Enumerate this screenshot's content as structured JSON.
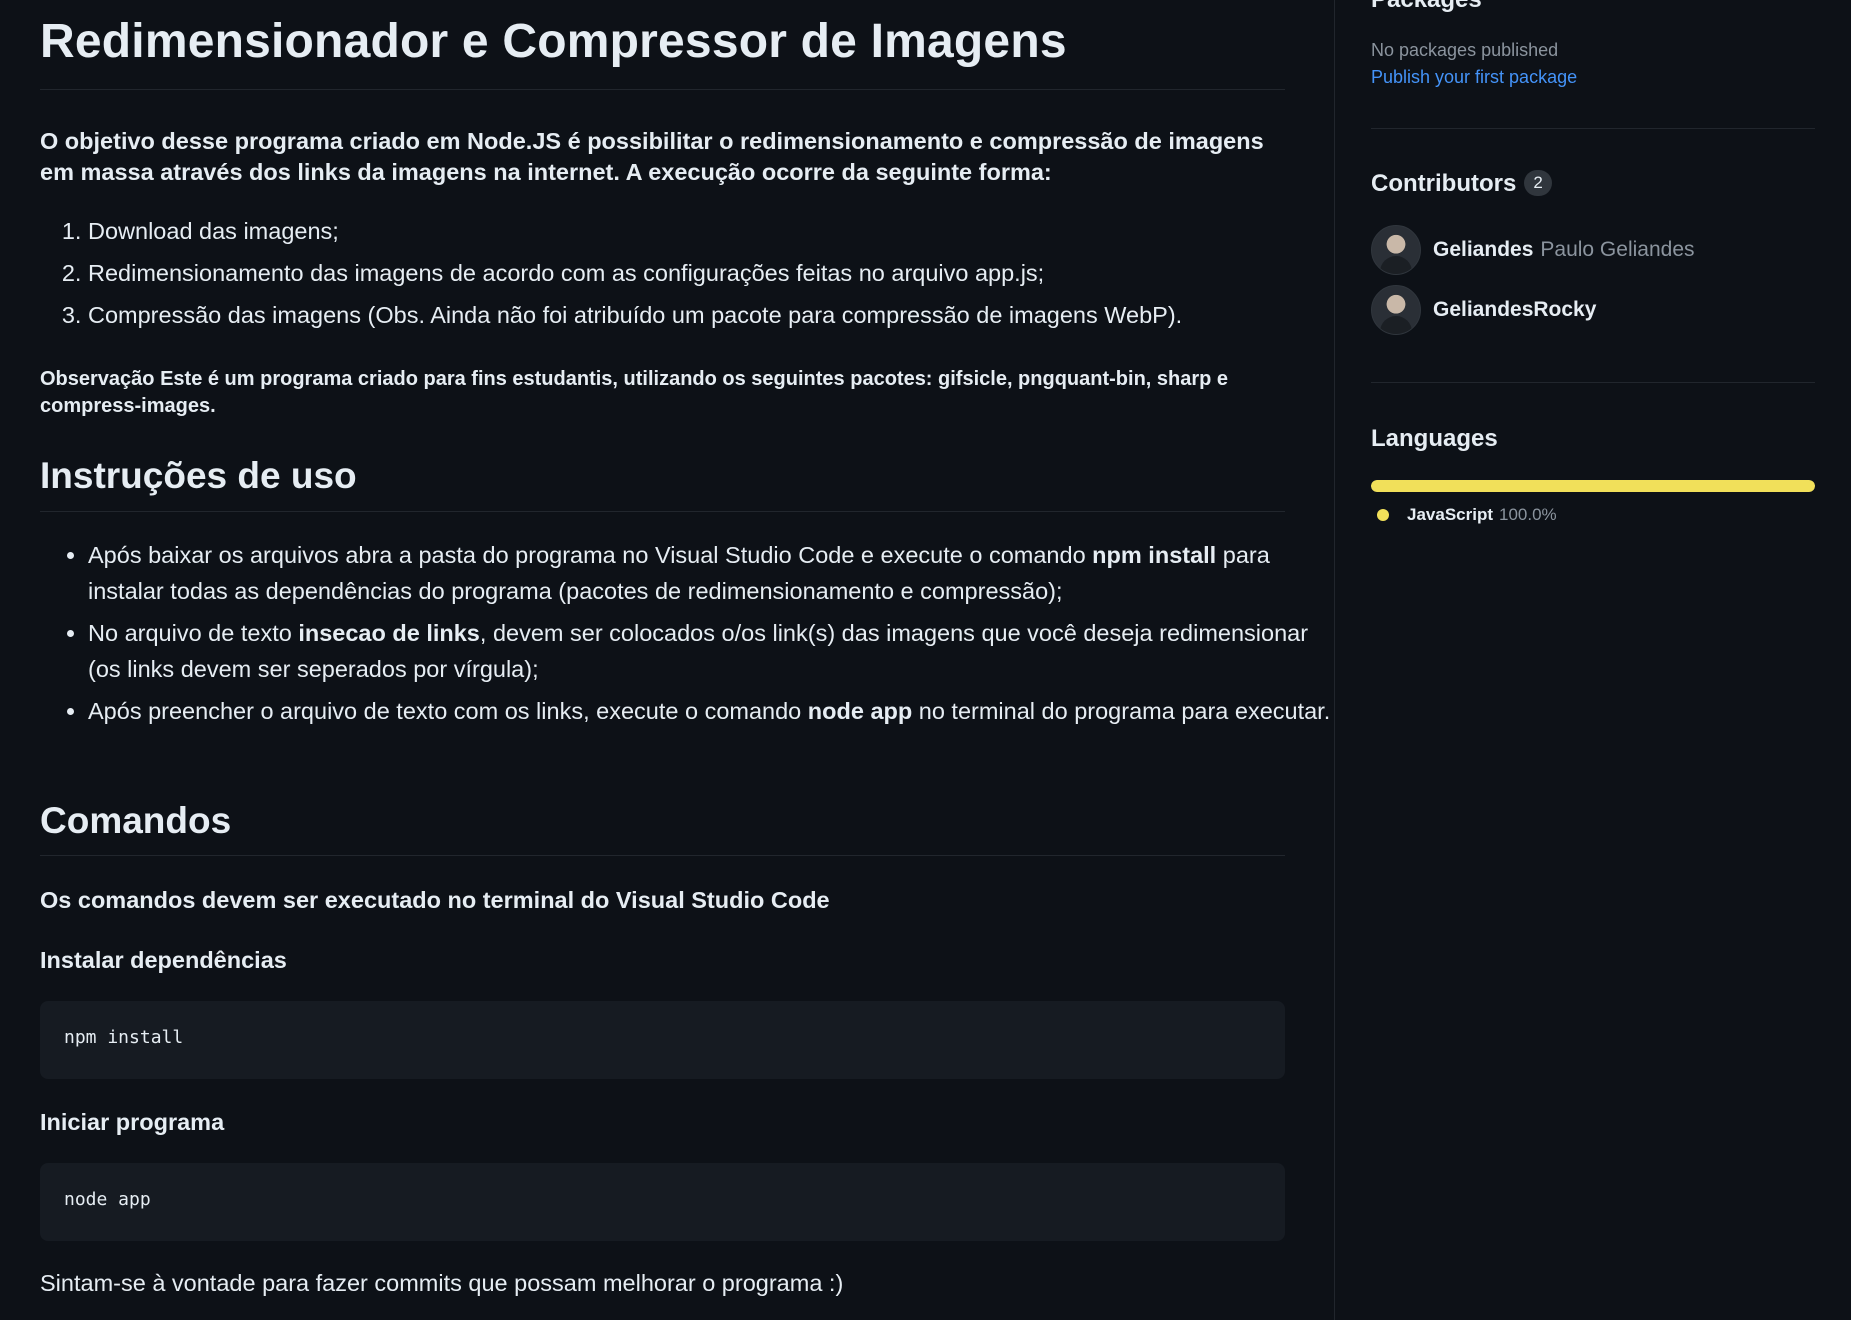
{
  "readme": {
    "title": "Redimensionador e Compressor de Imagens",
    "intro": "O objetivo desse programa criado em Node.JS é possibilitar o redimensionamento e compressão de imagens em massa através dos links da imagens na internet. A execução ocorre da seguinte forma:",
    "steps": [
      "Download das imagens;",
      "Redimensionamento das imagens de acordo com as configurações feitas no arquivo app.js;",
      "Compressão das imagens (Obs. Ainda não foi atribuído um pacote para compressão de imagens WebP)."
    ],
    "observation": "Observação Este é um programa criado para fins estudantis, utilizando os seguintes pacotes: gifsicle, pngquant-bin, sharp e compress-images.",
    "usage_heading": "Instruções de uso",
    "usage": [
      {
        "before": "Após baixar os arquivos abra a pasta do programa no Visual Studio Code e execute o comando ",
        "bold": "npm install",
        "after": " para instalar todas as dependências do programa (pacotes de redimensionamento e compressão);"
      },
      {
        "before": "No arquivo de texto ",
        "bold": "insecao de links",
        "after": ", devem ser colocados o/os link(s) das imagens que você deseja redimensionar (os links devem ser seperados por vírgula);"
      },
      {
        "before": "Após preencher o arquivo de texto com os links, execute o comando ",
        "bold": "node app",
        "after": " no terminal do programa para executar."
      }
    ],
    "commands_heading": "Comandos",
    "commands_note": "Os comandos devem ser executado no terminal do Visual Studio Code",
    "install_heading": "Instalar dependências",
    "install_code": "npm install",
    "start_heading": "Iniciar programa",
    "start_code": "node app",
    "closing": "Sintam-se à vontade para fazer commits que possam melhorar o programa :)"
  },
  "sidebar": {
    "packages": {
      "title": "Packages",
      "empty": "No packages published",
      "link": "Publish your first package"
    },
    "contributors": {
      "title": "Contributors",
      "count": "2",
      "people": [
        {
          "login": "Geliandes",
          "name": "Paulo Geliandes"
        },
        {
          "login": "GeliandesRocky",
          "name": ""
        }
      ]
    },
    "languages": {
      "title": "Languages",
      "items": [
        {
          "name": "JavaScript",
          "percent": "100.0%",
          "fraction": 1.0,
          "color": "#f1e05a"
        }
      ]
    }
  }
}
